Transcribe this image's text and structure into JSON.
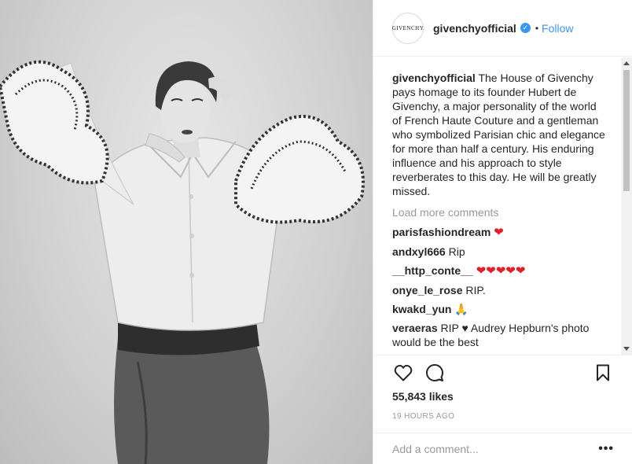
{
  "post": {
    "username": "givenchyofficial",
    "avatar_text": "GIVENCHY",
    "follow_label": "Follow",
    "dot": "•",
    "verified_glyph": "✓",
    "caption_user": "givenchyofficial",
    "caption_text": "The House of Givenchy pays homage to its founder Hubert de Givenchy, a major personality of the world of French Haute Couture and a gentleman who symbolized Parisian chic and elegance for more than half a century. His enduring influence and his approach to style reverberates to this day. He will be greatly missed.",
    "load_more": "Load more comments",
    "comments": [
      {
        "user": "parisfashiondream",
        "text": "",
        "emoji": "❤"
      },
      {
        "user": "andxyl666",
        "text": "Rip",
        "emoji": ""
      },
      {
        "user": "__http_conte__",
        "text": "",
        "emoji": "❤❤❤❤❤"
      },
      {
        "user": "onye_le_rose",
        "text": "RIP.",
        "emoji": ""
      },
      {
        "user": "kwakd_yun",
        "text": "",
        "emoji": "🙏"
      },
      {
        "user": "veraeras",
        "text": "RIP ♥ Audrey Hepburn's photo would be the best",
        "emoji": ""
      }
    ],
    "likes": "55,843 likes",
    "time": "19 HOURS AGO",
    "comment_placeholder": "Add a comment...",
    "more_glyph": "•••"
  },
  "icons": [
    "heart-icon",
    "comment-icon",
    "bookmark-icon",
    "scroll-up-icon",
    "scroll-down-icon"
  ]
}
